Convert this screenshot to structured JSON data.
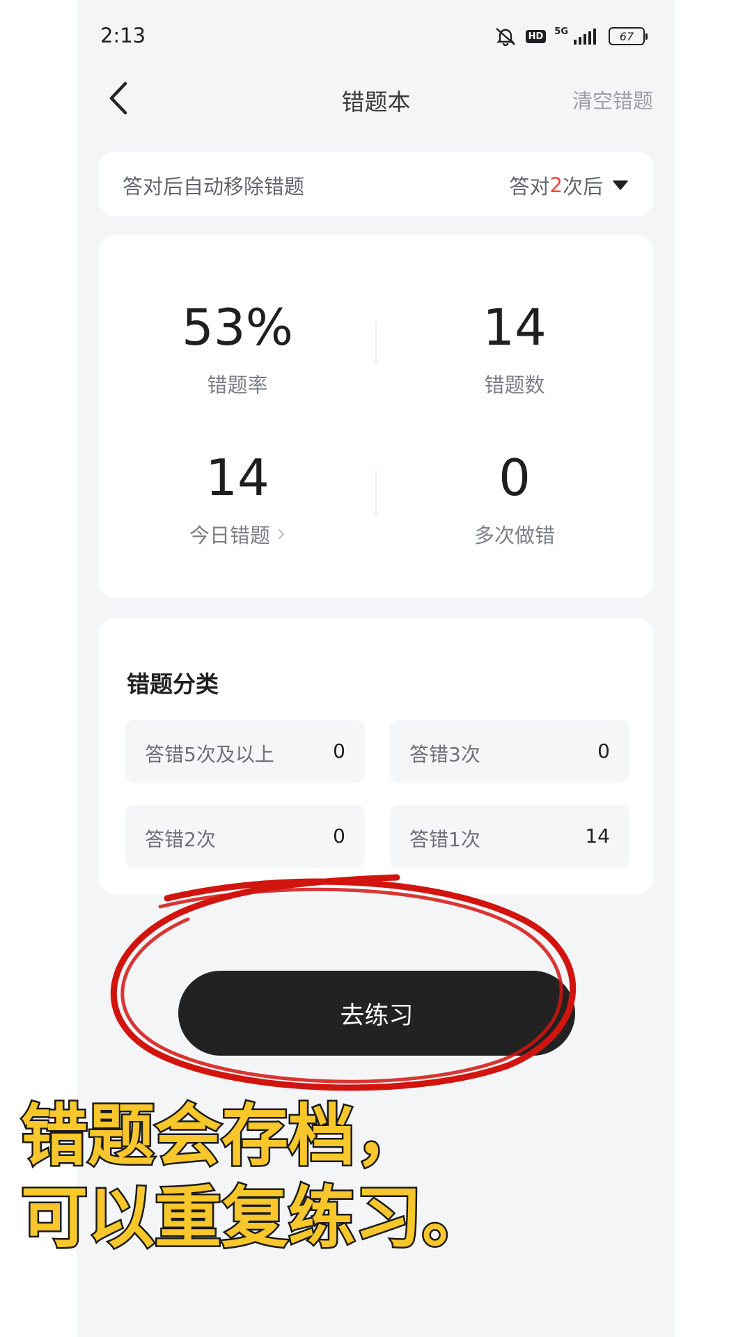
{
  "status_bar": {
    "time": "2:13",
    "hd": "HD",
    "network": "5G",
    "battery": "67"
  },
  "nav": {
    "title": "错题本",
    "clear": "清空错题"
  },
  "auto_remove": {
    "label": "答对后自动移除错题",
    "prefix": "答对",
    "count": "2",
    "suffix": "次后"
  },
  "stats": {
    "error_rate": {
      "value": "53%",
      "label": "错题率"
    },
    "error_count": {
      "value": "14",
      "label": "错题数"
    },
    "today_errors": {
      "value": "14",
      "label": "今日错题"
    },
    "repeat_errors": {
      "value": "0",
      "label": "多次做错"
    }
  },
  "categories": {
    "title": "错题分类",
    "items": [
      {
        "name": "答错5次及以上",
        "count": "0"
      },
      {
        "name": "答错3次",
        "count": "0"
      },
      {
        "name": "答错2次",
        "count": "0"
      },
      {
        "name": "答错1次",
        "count": "14"
      }
    ]
  },
  "practice_button": "去练习",
  "caption": {
    "line1": "错题会存档，",
    "line2": "可以重复练习。"
  },
  "colors": {
    "accent_red": "#f0483e",
    "annotation_red": "#d2140f",
    "caption_yellow": "#f7c72b",
    "button_dark": "#222222"
  }
}
